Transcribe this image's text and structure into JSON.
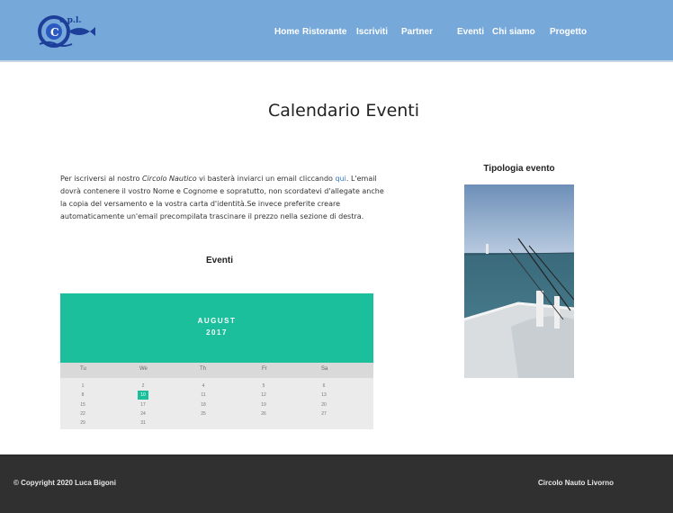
{
  "header": {
    "logo_alt": "c.p.l.",
    "nav": [
      "Home",
      "Ristorante",
      "Iscriviti",
      "Partner",
      "Eventi",
      "Chi siamo",
      "Progetto"
    ]
  },
  "main": {
    "title": "Calendario Eventi",
    "intro_before": "Per iscriversi al nostro ",
    "intro_em": "Circolo Nautico",
    "intro_mid": " vi basterà inviarci un email cliccando ",
    "intro_link": "qui",
    "intro_after": ". L'email dovrà contenere il vostro Nome e Cognome e sopratutto, non scordatevi d'allegate anche la copia del versamento e la vostra carta d'identità.Se invece preferite creare automaticamente un'email precompilata trascinare il prezzo nella sezione di destra.",
    "events_heading": "Eventi",
    "sidebar_heading": "Tipologia evento"
  },
  "calendar": {
    "month": "AUGUST",
    "year": "2017",
    "weekdays": [
      "Tu",
      "We",
      "Th",
      "Fr",
      "Sa"
    ],
    "rows": [
      [
        "1",
        "2",
        "4",
        "5",
        "6"
      ],
      [
        "8",
        "10",
        "11",
        "12",
        "13"
      ],
      [
        "15",
        "17",
        "18",
        "19",
        "20"
      ],
      [
        "22",
        "24",
        "25",
        "26",
        "27"
      ],
      [
        "29",
        "31",
        "",
        "",
        ""
      ]
    ],
    "selected": "10"
  },
  "footer": {
    "copyright": "© Copyright 2020 Luca Bigoni",
    "site": "Circolo Nauto Livorno"
  }
}
